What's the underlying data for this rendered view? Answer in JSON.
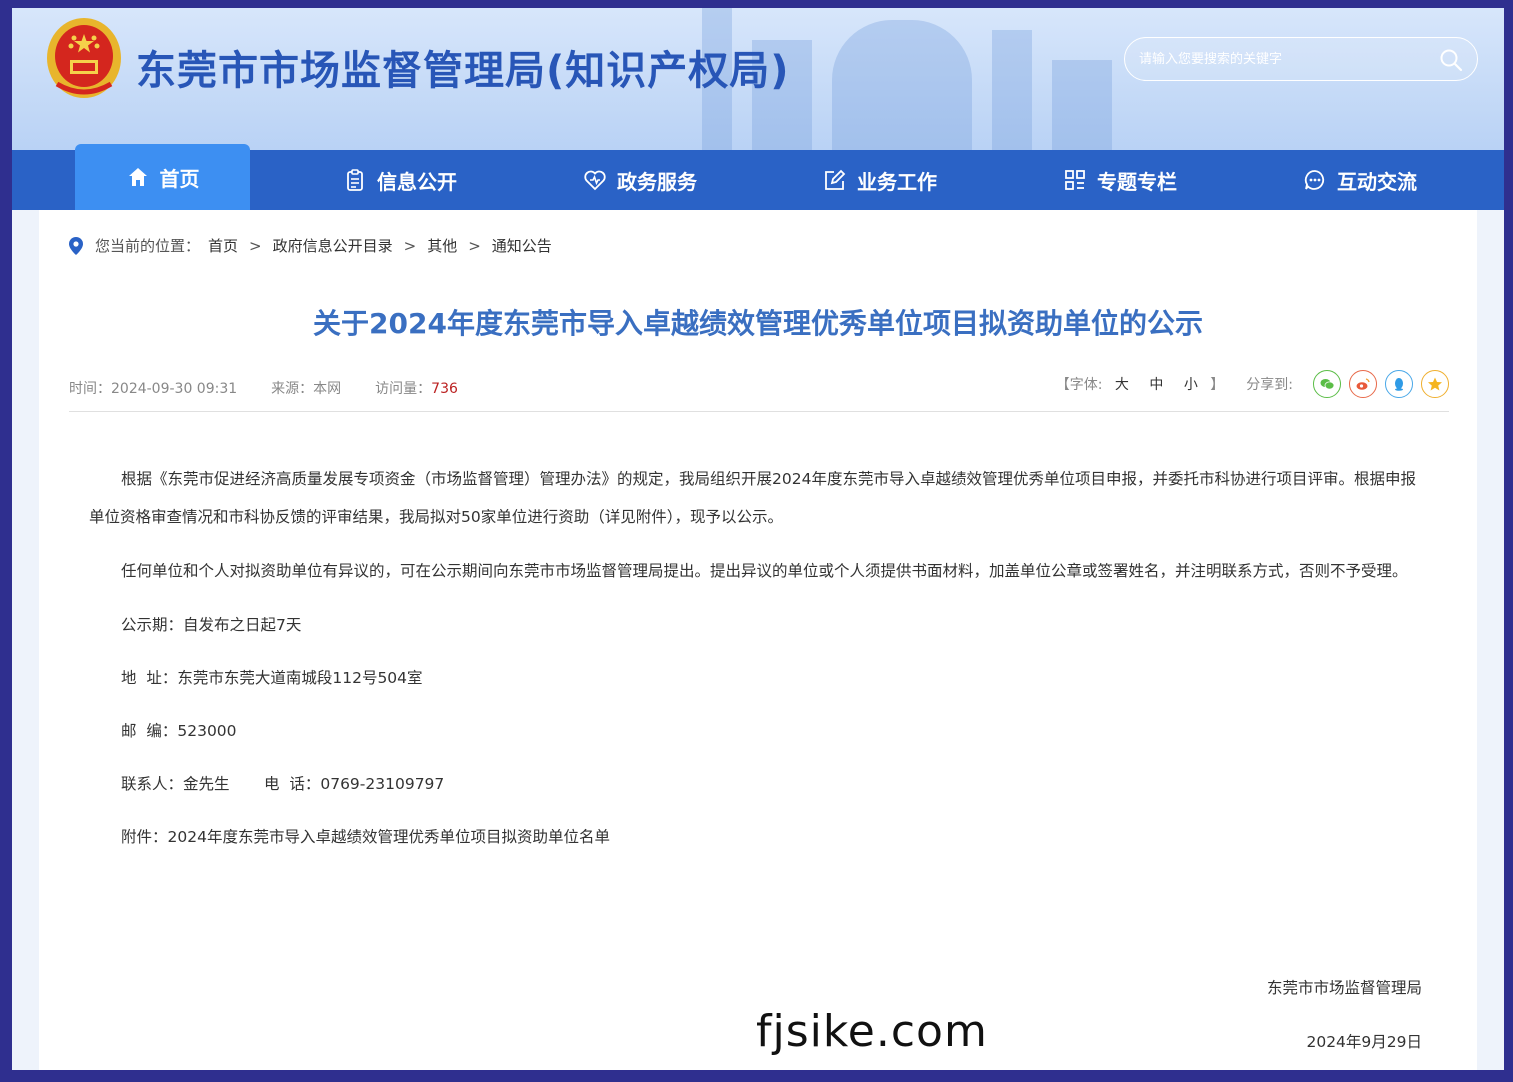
{
  "header": {
    "site_title": "东莞市市场监督管理局(知识产权局)",
    "search_placeholder": "请输入您要搜索的关键字"
  },
  "nav": {
    "items": [
      {
        "label": "首页",
        "icon": "home-icon"
      },
      {
        "label": "信息公开",
        "icon": "clipboard-icon"
      },
      {
        "label": "政务服务",
        "icon": "heart-icon"
      },
      {
        "label": "业务工作",
        "icon": "edit-icon"
      },
      {
        "label": "专题专栏",
        "icon": "grid-icon"
      },
      {
        "label": "互动交流",
        "icon": "chat-icon"
      }
    ]
  },
  "breadcrumb": {
    "prefix": "您当前的位置：",
    "items": [
      "首页",
      "政府信息公开目录",
      "其他",
      "通知公告"
    ],
    "separator": ">"
  },
  "article": {
    "title": "关于2024年度东莞市导入卓越绩效管理优秀单位项目拟资助单位的公示",
    "time_label": "时间：",
    "time": "2024-09-30 09:31",
    "source_label": "来源：",
    "source": "本网",
    "visits_label": "访问量：",
    "visits": "736",
    "font_open": "【字体:",
    "font_large": "大",
    "font_medium": "中",
    "font_small": "小",
    "font_close": "】",
    "share_label": "分享到:",
    "share": [
      "wechat-icon",
      "weibo-icon",
      "qq-icon",
      "qzone-icon"
    ],
    "paragraphs": [
      "根据《东莞市促进经济高质量发展专项资金（市场监督管理）管理办法》的规定，我局组织开展2024年度东莞市导入卓越绩效管理优秀单位项目申报，并委托市科协进行项目评审。根据申报单位资格审查情况和市科协反馈的评审结果，我局拟对50家单位进行资助（详见附件），现予以公示。",
      "任何单位和个人对拟资助单位有异议的，可在公示期间向东莞市市场监督管理局提出。提出异议的单位或个人须提供书面材料，加盖单位公章或签署姓名，并注明联系方式，否则不予受理。"
    ],
    "lines": [
      "公示期：自发布之日起7天",
      "地  址：东莞市东莞大道南城段112号504室",
      "邮  编：523000",
      "联系人：金先生       电  话：0769-23109797",
      "附件：2024年度东莞市导入卓越绩效管理优秀单位项目拟资助单位名单"
    ],
    "signature": "东莞市市场监督管理局",
    "date": "2024年9月29日"
  },
  "watermark": "fjsike.com",
  "colors": {
    "nav_bg": "#2a62c6",
    "nav_active": "#3d8ff2",
    "title": "#3a6fc1",
    "site_title": "#2856b7"
  }
}
